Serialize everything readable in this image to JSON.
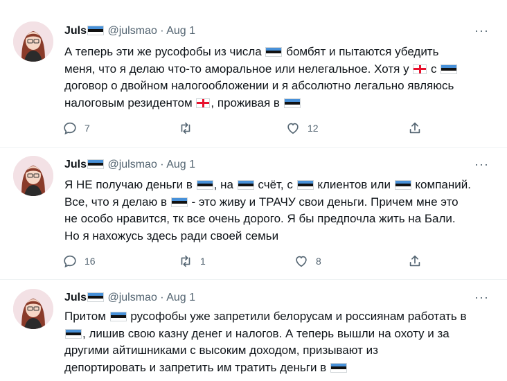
{
  "tweets": [
    {
      "name": "Juls",
      "handle": "@julsmao",
      "dot": "·",
      "date": "Aug 1",
      "more_label": "···",
      "text": {
        "l1a": "А теперь эти же русофобы из числа",
        "l1b": "бомбят и пытаются убедить",
        "l2a": "меня, что я делаю что-то аморальное или нелегальное. Хотя у",
        "l2b": "с",
        "l3": "договор о двойном налогообложении и я абсолютно легально являюсь",
        "l4a": "налоговым резидентом",
        "l4b": ", проживая в"
      },
      "replies": "7",
      "retweets": "",
      "likes": "12"
    },
    {
      "name": "Juls",
      "handle": "@julsmao",
      "dot": "·",
      "date": "Aug 1",
      "more_label": "···",
      "text": {
        "l1a": "Я НЕ получаю деньги в",
        "l1b": ", на",
        "l1c": "счёт, с",
        "l1d": "клиентов или",
        "l1e": "компаний.",
        "l2a": "Все, что я делаю в",
        "l2b": "- это живу и ТРАЧУ свои деньги. Причем мне это",
        "l3": "не особо нравится, тк все очень дорого. Я бы предпочла жить на Бали.",
        "l4": "Но я нахожусь здесь ради своей семьи"
      },
      "replies": "16",
      "retweets": "1",
      "likes": "8"
    },
    {
      "name": "Juls",
      "handle": "@julsmao",
      "dot": "·",
      "date": "Aug 1",
      "more_label": "···",
      "text": {
        "l1a": "Притом",
        "l1b": "русофобы уже запретили белорусам и россиянам работать в",
        "l2": ", лишив свою казну денег и налогов. А теперь вышли на охоту и за",
        "l3": "другими айтишниками с высоким доходом, призывают из",
        "l4": "депортировать и запретить им тратить деньги в"
      }
    }
  ],
  "colors": {
    "text": "#0f1419",
    "muted": "#536471",
    "separator": "#eff3f4"
  },
  "icons": [
    "reply-icon",
    "retweet-icon",
    "like-icon",
    "share-icon",
    "more-icon",
    "estonia-flag-icon",
    "georgia-flag-icon"
  ]
}
